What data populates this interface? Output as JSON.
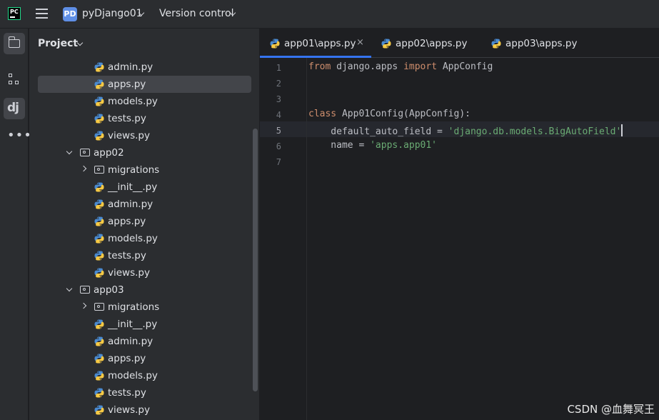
{
  "titlebar": {
    "app_logo_text": "PC",
    "project_badge": "PD",
    "project_name": "pyDjango01",
    "vcs_label": "Version control"
  },
  "toolstrip": {
    "items": [
      {
        "name": "project-tool",
        "icon": "folder-icon",
        "active": true
      },
      {
        "name": "structure-tool",
        "icon": "structure-icon",
        "active": false
      },
      {
        "name": "django-tool",
        "icon": "django-icon",
        "active": true
      },
      {
        "name": "more-tools",
        "icon": "more-icon",
        "active": false
      }
    ],
    "django_label": "dj"
  },
  "project_panel": {
    "title": "Project",
    "tree": [
      {
        "label": "admin.py",
        "type": "file"
      },
      {
        "label": "apps.py",
        "type": "file",
        "selected": true
      },
      {
        "label": "models.py",
        "type": "file"
      },
      {
        "label": "tests.py",
        "type": "file"
      },
      {
        "label": "views.py",
        "type": "file"
      },
      {
        "label": "app02",
        "type": "dir",
        "expanded": true
      },
      {
        "label": "migrations",
        "type": "dir",
        "expanded": false
      },
      {
        "label": "__init__.py",
        "type": "file"
      },
      {
        "label": "admin.py",
        "type": "file"
      },
      {
        "label": "apps.py",
        "type": "file"
      },
      {
        "label": "models.py",
        "type": "file"
      },
      {
        "label": "tests.py",
        "type": "file"
      },
      {
        "label": "views.py",
        "type": "file"
      },
      {
        "label": "app03",
        "type": "dir",
        "expanded": true
      },
      {
        "label": "migrations",
        "type": "dir",
        "expanded": false
      },
      {
        "label": "__init__.py",
        "type": "file"
      },
      {
        "label": "admin.py",
        "type": "file"
      },
      {
        "label": "apps.py",
        "type": "file"
      },
      {
        "label": "models.py",
        "type": "file"
      },
      {
        "label": "tests.py",
        "type": "file"
      },
      {
        "label": "views.py",
        "type": "file"
      }
    ]
  },
  "editor": {
    "tabs": [
      {
        "label": "app01\\apps.py",
        "active": true
      },
      {
        "label": "app02\\apps.py",
        "active": false
      },
      {
        "label": "app03\\apps.py",
        "active": false
      }
    ],
    "close_glyph": "×",
    "current_line": 5,
    "lines": [
      {
        "n": "1",
        "code": [
          {
            "t": "from",
            "c": "kw"
          },
          {
            "t": " django.apps ",
            "c": ""
          },
          {
            "t": "import",
            "c": "kw"
          },
          {
            "t": " AppConfig",
            "c": ""
          }
        ]
      },
      {
        "n": "2",
        "code": []
      },
      {
        "n": "3",
        "code": []
      },
      {
        "n": "4",
        "code": [
          {
            "t": "class",
            "c": "kw"
          },
          {
            "t": " App01Config(AppConfig):",
            "c": ""
          }
        ]
      },
      {
        "n": "5",
        "code": [
          {
            "t": "    default_auto_field = ",
            "c": ""
          },
          {
            "t": "'django.db.models.BigAutoField'",
            "c": "str"
          }
        ]
      },
      {
        "n": "6",
        "code": [
          {
            "t": "    name = ",
            "c": ""
          },
          {
            "t": "'apps.app01'",
            "c": "str"
          }
        ]
      },
      {
        "n": "7",
        "code": []
      }
    ]
  },
  "watermark": "CSDN @血舞冥王",
  "colors": {
    "accent": "#3574f0",
    "keyword": "#cf8e6d",
    "string": "#6aab73",
    "panel_bg": "#2b2d30",
    "editor_bg": "#1e1f22"
  }
}
